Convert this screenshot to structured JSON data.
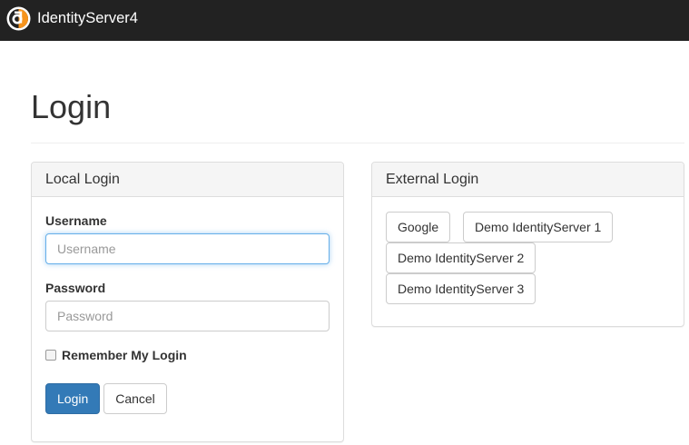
{
  "navbar": {
    "brand": "IdentityServer4",
    "logo_icon": "identityserver-logo-icon",
    "bg_color": "#222222"
  },
  "page": {
    "title": "Login"
  },
  "local_login": {
    "heading": "Local Login",
    "username_label": "Username",
    "username_placeholder": "Username",
    "password_label": "Password",
    "password_placeholder": "Password",
    "remember_label": "Remember My Login",
    "remember_checked": false,
    "login_button": "Login",
    "cancel_button": "Cancel"
  },
  "external_login": {
    "heading": "External Login",
    "providers": [
      "Google",
      "Demo IdentityServer 1",
      "Demo IdentityServer 2",
      "Demo IdentityServer 3"
    ]
  },
  "colors": {
    "primary": "#337ab7",
    "focus": "#66afe9"
  }
}
